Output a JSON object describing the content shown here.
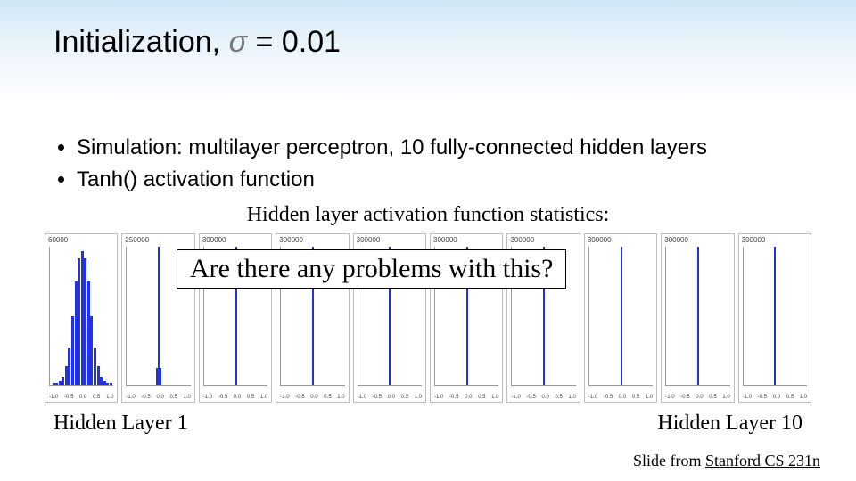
{
  "title": {
    "word": "Initialization,",
    "sigma": "σ",
    "eq": "= 0.01"
  },
  "bullets": [
    "Simulation: multilayer perceptron, 10 fully-connected hidden layers",
    "Tanh() activation function"
  ],
  "subheader": "Hidden layer activation function statistics:",
  "callout": "Are there any problems with this?",
  "layer_label_left": "Hidden Layer 1",
  "layer_label_right": "Hidden Layer 10",
  "credit_prefix": "Slide from ",
  "credit_link": "Stanford CS 231n",
  "xticks": [
    "-1.0",
    "-0.5",
    "0.0",
    "0.5",
    "1.0"
  ],
  "chart_data": [
    {
      "type": "bar",
      "title": "",
      "xlabel": "",
      "ylabel": "",
      "ylim": [
        0,
        60000
      ],
      "ymax_label": "60000",
      "x": [
        -0.9,
        -0.8,
        -0.7,
        -0.6,
        -0.5,
        -0.4,
        -0.3,
        -0.2,
        -0.1,
        0.0,
        0.1,
        0.2,
        0.3,
        0.4,
        0.5,
        0.6,
        0.7,
        0.8,
        0.9
      ],
      "values": [
        200,
        600,
        1500,
        3500,
        8000,
        16000,
        30000,
        45000,
        55000,
        58000,
        55000,
        45000,
        30000,
        16000,
        8000,
        3500,
        1500,
        600,
        200
      ]
    },
    {
      "type": "bar",
      "ylim": [
        0,
        250000
      ],
      "ymax_label": "250000",
      "x": [
        -0.05,
        0.0,
        0.05
      ],
      "values": [
        30000,
        250000,
        30000
      ]
    },
    {
      "type": "bar",
      "ylim": [
        0,
        300000
      ],
      "ymax_label": "300000",
      "x": [
        0.0
      ],
      "values": [
        300000
      ]
    },
    {
      "type": "bar",
      "ylim": [
        0,
        300000
      ],
      "ymax_label": "300000",
      "x": [
        0.0
      ],
      "values": [
        300000
      ]
    },
    {
      "type": "bar",
      "ylim": [
        0,
        300000
      ],
      "ymax_label": "300000",
      "x": [
        0.0
      ],
      "values": [
        300000
      ]
    },
    {
      "type": "bar",
      "ylim": [
        0,
        300000
      ],
      "ymax_label": "300000",
      "x": [
        0.0
      ],
      "values": [
        300000
      ]
    },
    {
      "type": "bar",
      "ylim": [
        0,
        300000
      ],
      "ymax_label": "300000",
      "x": [
        0.0
      ],
      "values": [
        300000
      ]
    },
    {
      "type": "bar",
      "ylim": [
        0,
        300000
      ],
      "ymax_label": "300000",
      "x": [
        0.0
      ],
      "values": [
        300000
      ]
    },
    {
      "type": "bar",
      "ylim": [
        0,
        300000
      ],
      "ymax_label": "300000",
      "x": [
        0.0
      ],
      "values": [
        300000
      ]
    },
    {
      "type": "bar",
      "ylim": [
        0,
        300000
      ],
      "ymax_label": "300000",
      "x": [
        0.0
      ],
      "values": [
        300000
      ]
    }
  ]
}
